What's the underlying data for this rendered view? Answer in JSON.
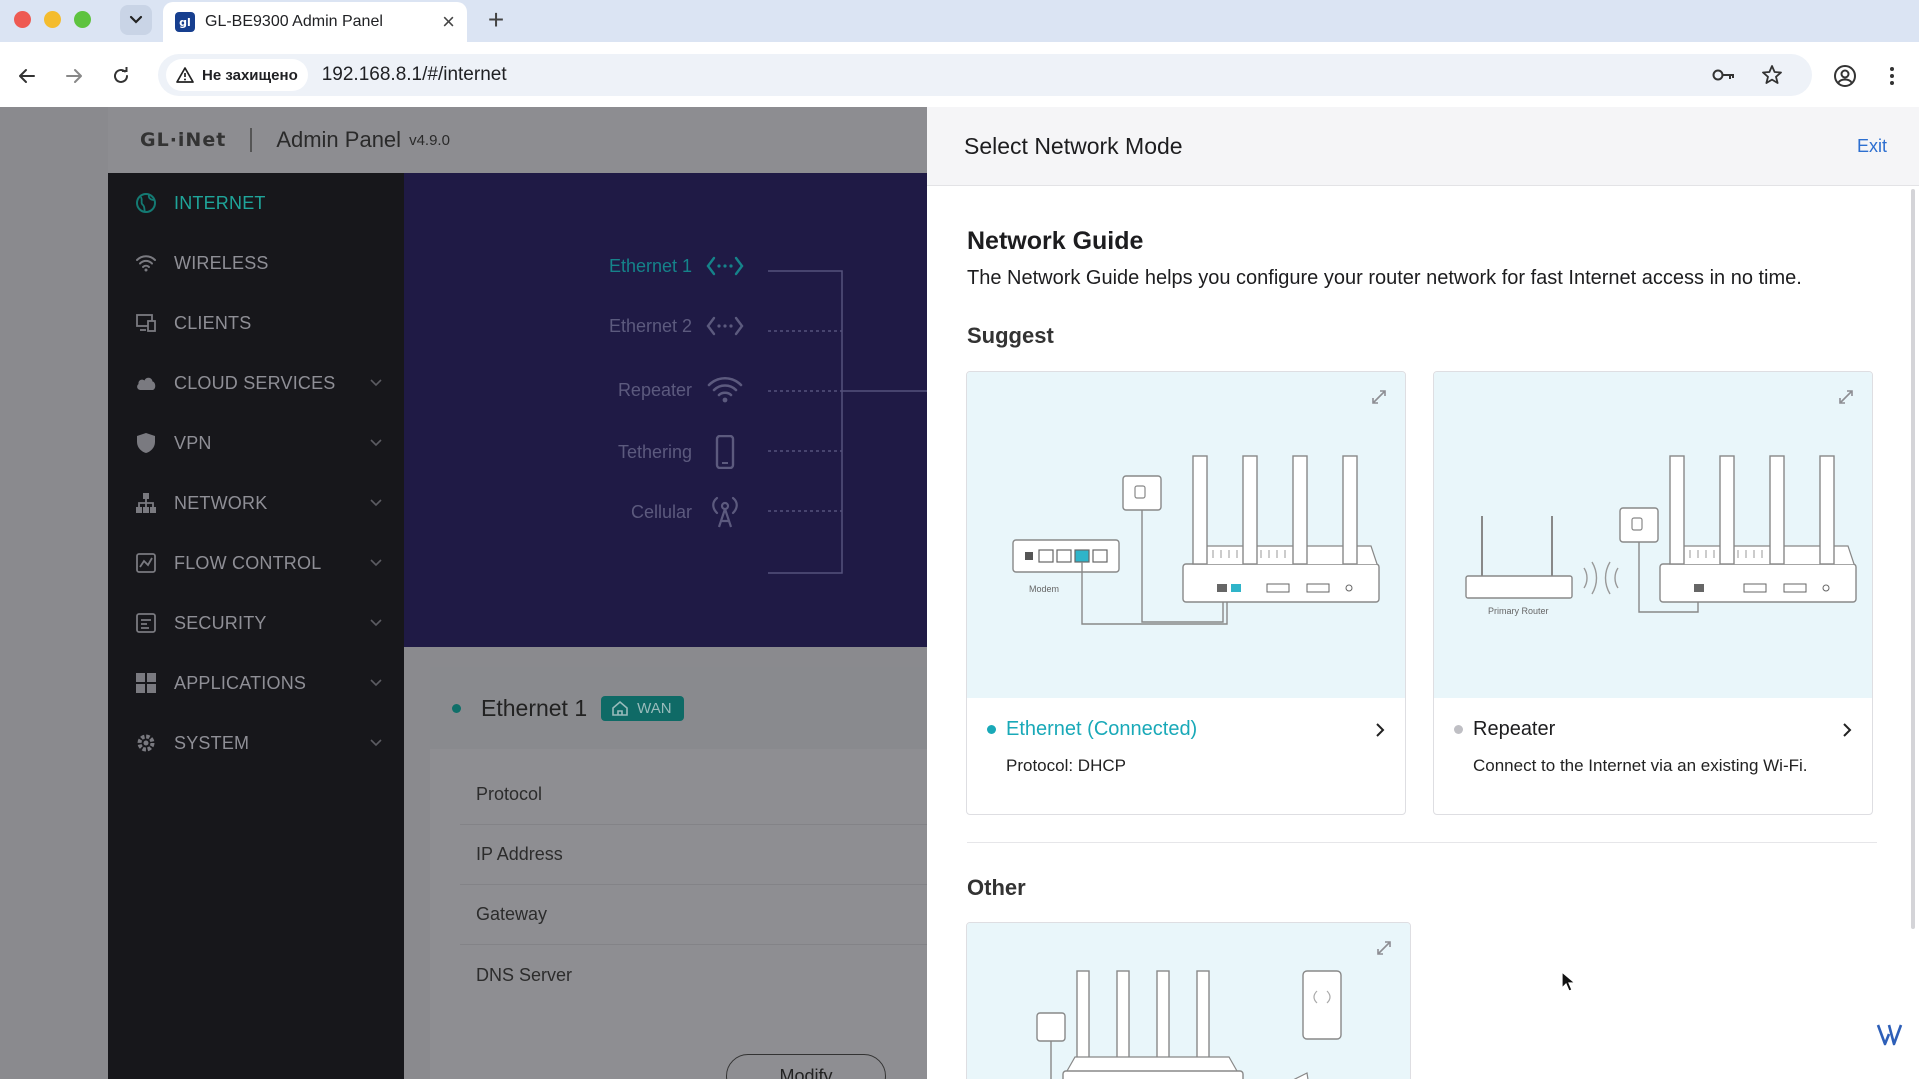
{
  "browser": {
    "tab_title": "GL-BE9300 Admin Panel",
    "favicon_text": "gl",
    "security_label": "Не захищено",
    "url": "192.168.8.1/#/internet"
  },
  "app": {
    "logo": "GL·iNet",
    "admin_title": "Admin Panel",
    "version": "v4.9.0",
    "accent_color": "#1fa59a"
  },
  "sidebar": {
    "items": [
      {
        "label": "INTERNET",
        "icon": "globe-icon",
        "active": true
      },
      {
        "label": "WIRELESS",
        "icon": "wifi-icon"
      },
      {
        "label": "CLIENTS",
        "icon": "devices-icon"
      },
      {
        "label": "CLOUD SERVICES",
        "icon": "cloud-icon"
      },
      {
        "label": "VPN",
        "icon": "shield-icon"
      },
      {
        "label": "NETWORK",
        "icon": "network-icon"
      },
      {
        "label": "FLOW CONTROL",
        "icon": "flow-icon"
      },
      {
        "label": "SECURITY",
        "icon": "security-icon"
      },
      {
        "label": "APPLICATIONS",
        "icon": "apps-icon"
      },
      {
        "label": "SYSTEM",
        "icon": "gear-icon"
      }
    ]
  },
  "topology": {
    "ethernet1": "Ethernet 1",
    "ethernet2": "Ethernet 2",
    "repeater": "Repeater",
    "tethering": "Tethering",
    "cellular": "Cellular"
  },
  "ethernet_panel": {
    "title": "Ethernet 1",
    "badge": "WAN",
    "rows": [
      "Protocol",
      "IP Address",
      "Gateway",
      "DNS Server"
    ],
    "modify_label": "Modify"
  },
  "drawer": {
    "title": "Select Network Mode",
    "exit_label": "Exit",
    "guide_title": "Network Guide",
    "guide_desc": "The Network Guide helps you configure your router network for fast Internet access in no time.",
    "suggest_heading": "Suggest",
    "other_heading": "Other",
    "cards": {
      "ethernet": {
        "name": "Ethernet (Connected)",
        "sub": "Protocol: DHCP",
        "illustration_label": "Modem",
        "status_color": "#19a9b8"
      },
      "repeater": {
        "name": "Repeater",
        "sub": "Connect to the Internet via an existing Wi-Fi.",
        "illustration_label": "Primary Router",
        "status_color": "#bfbfc4"
      }
    }
  }
}
